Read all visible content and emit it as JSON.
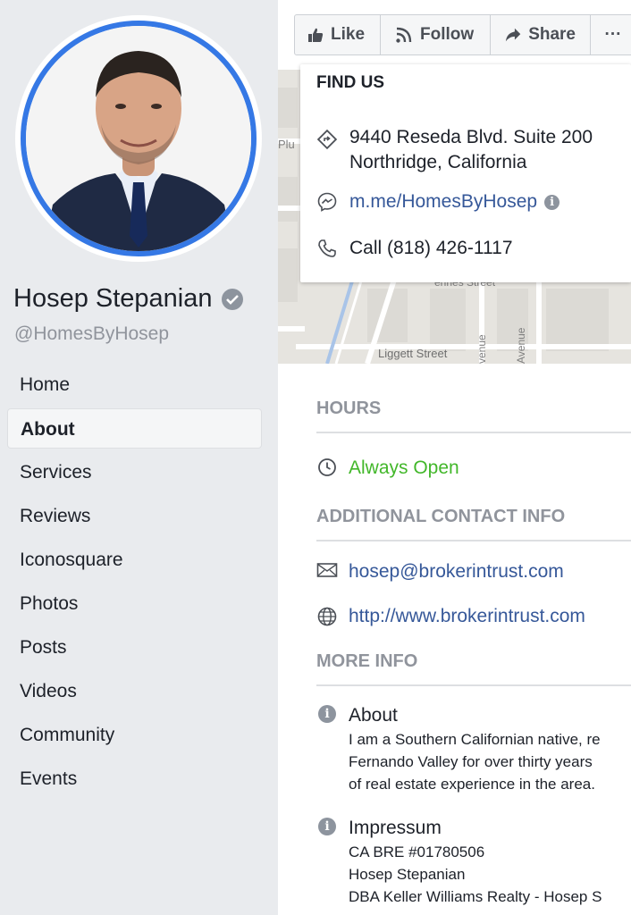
{
  "profile": {
    "name": "Hosep Stepanian",
    "handle": "@HomesByHosep"
  },
  "nav": {
    "items": [
      {
        "label": "Home"
      },
      {
        "label": "About"
      },
      {
        "label": "Services"
      },
      {
        "label": "Reviews"
      },
      {
        "label": "Iconosquare"
      },
      {
        "label": "Photos"
      },
      {
        "label": "Posts"
      },
      {
        "label": "Videos"
      },
      {
        "label": "Community"
      },
      {
        "label": "Events"
      }
    ],
    "active": "About"
  },
  "actions": {
    "like": "Like",
    "follow": "Follow",
    "share": "Share",
    "more": "···"
  },
  "map": {
    "labels": {
      "plu": "Plu",
      "street_top": "ennes Street",
      "liggett": "Liggett Street",
      "venue1": "venue",
      "venue2": "Avenue"
    }
  },
  "find_us": {
    "title": "FIND US",
    "address_line1": "9440 Reseda Blvd. Suite 200",
    "address_line2": "Northridge, California",
    "messenger": "m.me/HomesByHosep",
    "phone": "Call (818) 426-1117"
  },
  "hours": {
    "title": "HOURS",
    "status": "Always Open"
  },
  "contact": {
    "title": "ADDITIONAL CONTACT INFO",
    "email": "hosep@brokerintrust.com",
    "website": "http://www.brokerintrust.com"
  },
  "more_info": {
    "title": "MORE INFO",
    "about_title": "About",
    "about_lines": [
      "I am a Southern Californian native, re",
      "Fernando Valley for over thirty years",
      "of real estate experience in the area."
    ],
    "impressum_title": "Impressum",
    "impressum_lines": [
      "CA BRE #01780506",
      "Hosep Stepanian",
      "DBA Keller Williams Realty - Hosep S"
    ]
  },
  "colors": {
    "accent_blue": "#3578e5",
    "link": "#365899",
    "open_green": "#42b72a",
    "section_gray": "#90949c"
  }
}
